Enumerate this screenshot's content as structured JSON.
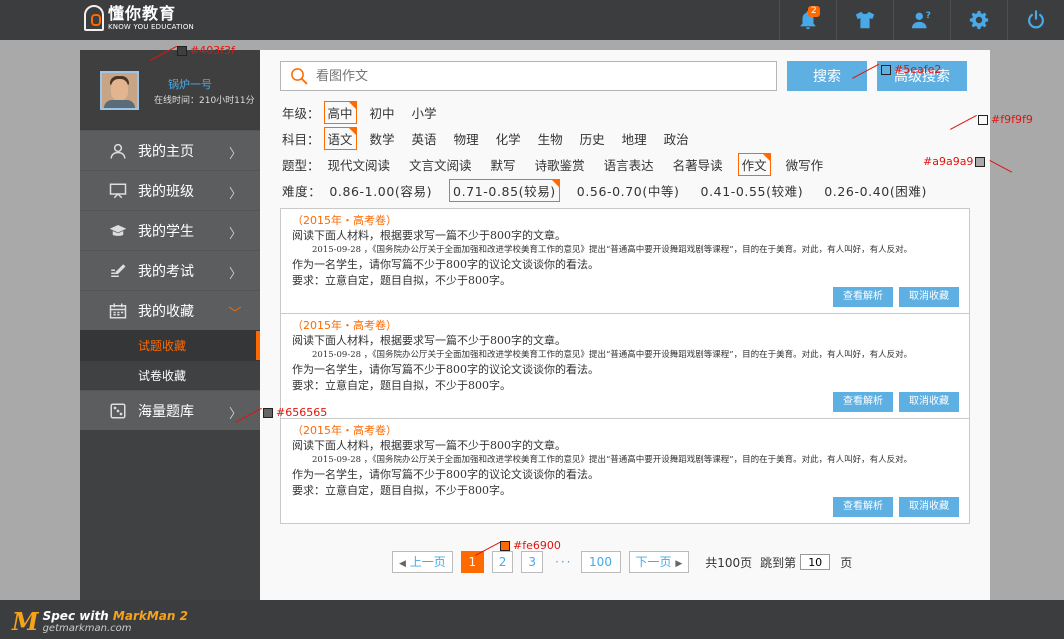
{
  "header": {
    "logo_cn": "懂你教育",
    "logo_en": "KNOW YOU EDUCATION",
    "notification_count": "2",
    "icons": [
      "bell-icon",
      "shirt-icon",
      "user-help-icon",
      "gear-icon",
      "power-icon"
    ]
  },
  "sidebar": {
    "user_name": "锅炉一号",
    "online_time": "在线时间：210小时11分",
    "items": [
      {
        "label": "我的主页",
        "icon": "user-icon"
      },
      {
        "label": "我的班级",
        "icon": "board-icon"
      },
      {
        "label": "我的学生",
        "icon": "graduation-cap-icon"
      },
      {
        "label": "我的考试",
        "icon": "exam-pen-icon"
      },
      {
        "label": "我的收藏",
        "icon": "calendar-icon"
      },
      {
        "label": "海量题库",
        "icon": "dice-icon"
      }
    ],
    "sub_items": [
      "试题收藏",
      "试卷收藏"
    ],
    "active_sub": "试题收藏"
  },
  "search": {
    "placeholder": "看图作文",
    "search_label": "搜索",
    "advanced_label": "高级搜索"
  },
  "filters": {
    "grade": {
      "label": "年级：",
      "options": [
        "高中",
        "初中",
        "小学"
      ],
      "selected": "高中"
    },
    "subject": {
      "label": "科目：",
      "options": [
        "语文",
        "数学",
        "英语",
        "物理",
        "化学",
        "生物",
        "历史",
        "地理",
        "政治"
      ],
      "selected": "语文"
    },
    "type": {
      "label": "题型：",
      "options": [
        "现代文阅读",
        "文言文阅读",
        "默写",
        "诗歌鉴赏",
        "语言表达",
        "名著导读",
        "作文",
        "微写作"
      ],
      "selected": "作文"
    },
    "difficulty": {
      "label": "难度：",
      "options": [
        "0.86-1.00(容易)",
        "0.71-0.85(较易)",
        "0.56-0.70(中等)",
        "0.41-0.55(较难)",
        "0.26-0.40(困难)"
      ],
      "selected": "0.71-0.85(较易)"
    }
  },
  "questions": [
    {
      "source": "（2015年・高考卷）",
      "line1": "阅读下面人材料，根据要求写一篇不少于800字的文章。",
      "small": "2015-09-28 ，《国务院办公厅关于全面加强和改进学校美育工作的意见》提出“普通高中要开设舞蹈戏剧等课程”，目的在于美育。对此，有人叫好，有人反对。",
      "line2": "作为一名学生，请你写篇不少于800字的议论文谈谈你的看法。",
      "line3": "要求：立意自定，题目自拟，不少于800字。",
      "view_label": "查看解析",
      "cancel_label": "取消收藏"
    },
    {
      "source": "（2015年・高考卷）",
      "line1": "阅读下面人材料，根据要求写一篇不少于800字的文章。",
      "small": "2015-09-28 ，《国务院办公厅关于全面加强和改进学校美育工作的意见》提出“普通高中要开设舞蹈戏剧等课程”，目的在于美育。对此，有人叫好，有人反对。",
      "line2": "作为一名学生，请你写篇不少于800字的议论文谈谈你的看法。",
      "line3": "要求：立意自定，题目自拟，不少于800字。",
      "view_label": "查看解析",
      "cancel_label": "取消收藏"
    },
    {
      "source": "（2015年・高考卷）",
      "line1": "阅读下面人材料，根据要求写一篇不少于800字的文章。",
      "small": "2015-09-28 ，《国务院办公厅关于全面加强和改进学校美育工作的意见》提出“普通高中要开设舞蹈戏剧等课程”，目的在于美育。对此，有人叫好，有人反对。",
      "line2": "作为一名学生，请你写篇不少于800字的议论文谈谈你的看法。",
      "line3": "要求：立意自定，题目自拟，不少于800字。",
      "view_label": "查看解析",
      "cancel_label": "取消收藏"
    }
  ],
  "pagination": {
    "prev_label": "上一页",
    "next_label": "下一页",
    "pages": [
      "1",
      "2",
      "3"
    ],
    "current": "1",
    "ellipsis": "···",
    "last": "100",
    "total": "共100页",
    "jump_label": "跳到第",
    "jump_value": "10",
    "page_suffix": "页"
  },
  "footer": {
    "spec_with": "Spec with",
    "markman": "MarkMan 2",
    "site": "getmarkman.com"
  },
  "annotations": [
    {
      "label": "#403f3f",
      "color": "#403f3f"
    },
    {
      "label": "#5eafe2",
      "color": "#5eafe2"
    },
    {
      "label": "#f9f9f9",
      "color": "#f9f9f9"
    },
    {
      "label": "#a9a9a9",
      "color": "#a9a9a9"
    },
    {
      "label": "#656565",
      "color": "#656565"
    },
    {
      "label": "#fe6900",
      "color": "#fe6900"
    }
  ],
  "colors": {
    "accent": "#fe6900",
    "blue": "#5eafe2",
    "sidebar": "#403f3f",
    "main_bg": "#f9f9f9",
    "page_bg": "#a9a9a9"
  }
}
